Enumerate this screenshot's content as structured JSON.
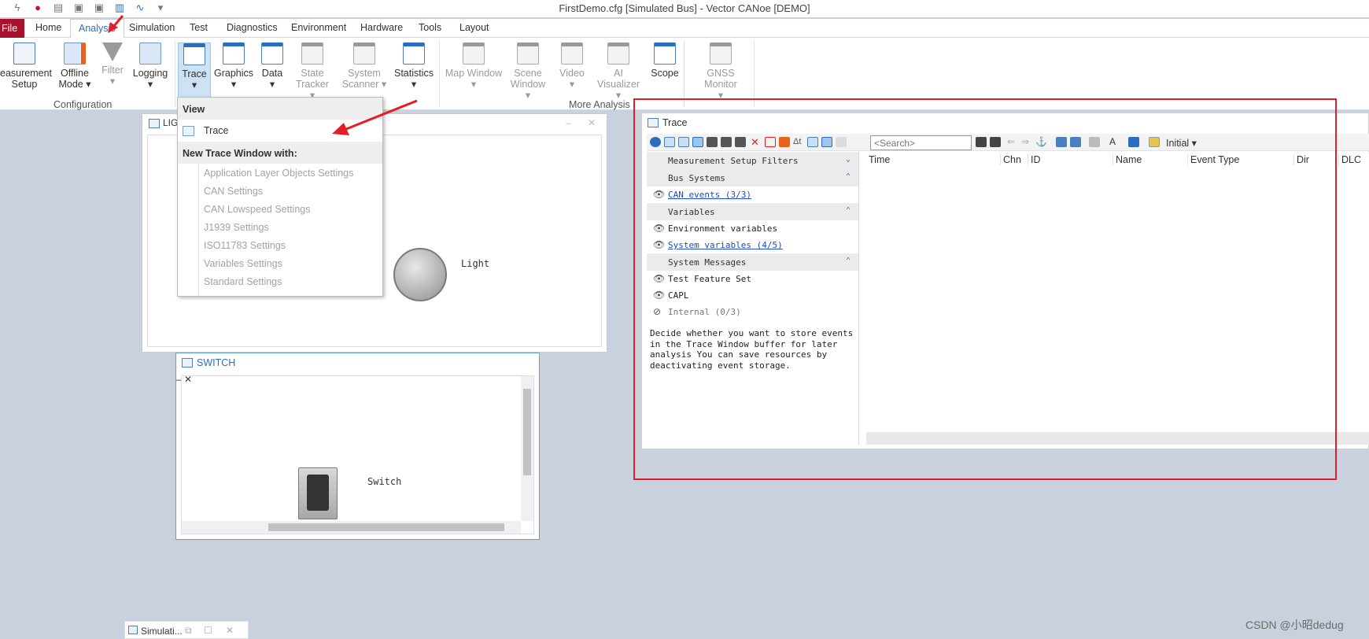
{
  "window": {
    "title": "FirstDemo.cfg [Simulated Bus] - Vector CANoe [DEMO]"
  },
  "menu": {
    "tabs": [
      "File",
      "Home",
      "Analysis",
      "Simulation",
      "Test",
      "Diagnostics",
      "Environment",
      "Hardware",
      "Tools",
      "Layout"
    ],
    "active": "Analysis"
  },
  "ribbon": {
    "buttons": [
      {
        "label1": "easurement",
        "label2": "Setup"
      },
      {
        "label1": "Offline",
        "label2": "Mode ▾"
      },
      {
        "label1": "Filter",
        "label2": "▾"
      },
      {
        "label1": "Logging",
        "label2": "▾"
      },
      {
        "label1": "Trace",
        "label2": "▾"
      },
      {
        "label1": "Graphics",
        "label2": "▾"
      },
      {
        "label1": "Data",
        "label2": "▾"
      },
      {
        "label1": "State",
        "label2": "Tracker ▾"
      },
      {
        "label1": "System",
        "label2": "Scanner ▾"
      },
      {
        "label1": "Statistics",
        "label2": "▾"
      },
      {
        "label1": "Map Window",
        "label2": "▾"
      },
      {
        "label1": "Scene",
        "label2": "Window ▾"
      },
      {
        "label1": "Video",
        "label2": "▾"
      },
      {
        "label1": "AI Visualizer",
        "label2": "▾"
      },
      {
        "label1": "Scope",
        "label2": ""
      },
      {
        "label1": "GNSS Monitor",
        "label2": "▾"
      }
    ],
    "groups": [
      "Configuration",
      "More Analysis"
    ]
  },
  "dropdown": {
    "view_header": "View",
    "view_item": "Trace",
    "new_header": "New Trace Window with:",
    "items": [
      "Application Layer Objects Settings",
      "CAN Settings",
      "CAN Lowspeed Settings",
      "J1939 Settings",
      "ISO11783 Settings",
      "Variables Settings",
      "Standard Settings"
    ]
  },
  "light_window": {
    "title": "LIG",
    "label": "Light"
  },
  "switch_window": {
    "title": "SWITCH",
    "label": "Switch"
  },
  "trace_window": {
    "title": "Trace",
    "search_placeholder": "<Search>",
    "initial": "Initial",
    "filters": {
      "measurement": "Measurement Setup Filters",
      "bus_systems": "Bus Systems",
      "can_events": "CAN events (3/3)",
      "variables": "Variables",
      "env_vars": "Environment variables",
      "sys_vars": "System variables (4/5)",
      "system_messages": "System Messages",
      "test_feature": "Test Feature Set",
      "capl": "CAPL",
      "internal": "Internal (0/3)",
      "description": "Decide whether you want to store events in the Trace Window buffer for later analysis You can save resources by deactivating event storage."
    },
    "columns": [
      "Time",
      "Chn",
      "ID",
      "Name",
      "Event Type",
      "Dir",
      "DLC"
    ]
  },
  "taskbar": {
    "sim_label": "Simulati..."
  },
  "watermark": "CSDN @小昭dedug",
  "colors": {
    "file_tab": "#a8122d",
    "accent": "#2a6ebd",
    "annotation": "#e41e26"
  }
}
